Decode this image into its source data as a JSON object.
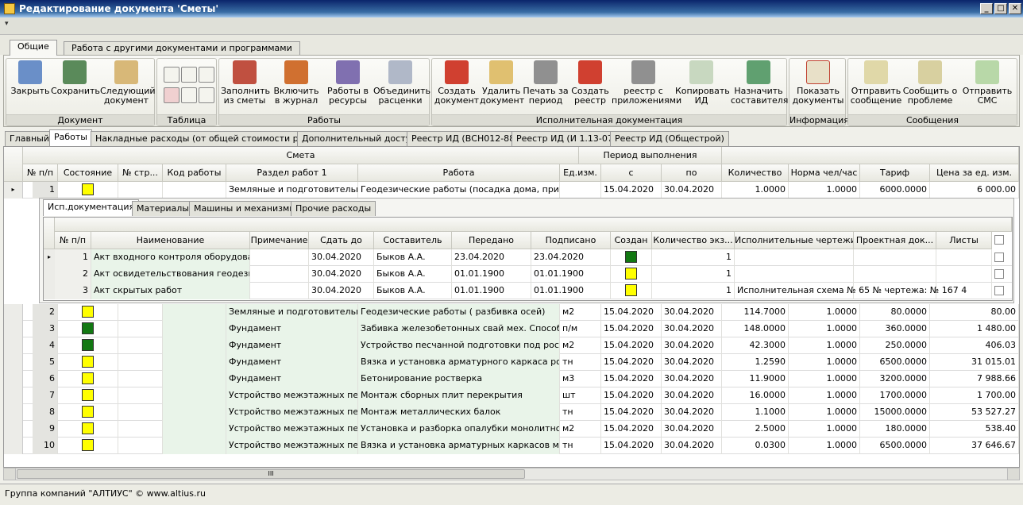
{
  "window": {
    "title": "Редактирование документа 'Сметы'",
    "min": "_",
    "max": "□",
    "close": "✕"
  },
  "qat": {
    "menu": "▾"
  },
  "ribbon_tabs": [
    "Общие",
    "Работа с другими документами и программами"
  ],
  "ribbon": {
    "groups": [
      "Документ",
      "Таблица",
      "Работы",
      "Исполнительная документация",
      "Информация",
      "Сообщения"
    ],
    "buttons": [
      "Закрыть",
      "Сохранить",
      "Следующий документ",
      "Заполнить из сметы",
      "Включить в журнал",
      "Работы в ресурсы",
      "Объединить расценки",
      "Создать документ",
      "Удалить документ",
      "Печать за период",
      "Создать реестр",
      "реестр с приложениями",
      "Копировать ИД",
      "Назначить составителя",
      "Показать документы",
      "Отправить сообщение",
      "Сообщить о проблеме",
      "Отправить СМС"
    ],
    "colors": {
      "arrow_red": "#cc2020",
      "green": "#2a9a40",
      "blue": "#3060c0"
    }
  },
  "doc_tabs": [
    "Главный",
    "Работы",
    "Накладные расходы (от общей стоимости работ)",
    "Дополнительный доступ",
    "Реестр ИД (ВСН012-88)",
    "Реестр ИД (И 1.13-07)",
    "Реестр ИД (Общестрой)"
  ],
  "grid": {
    "group_headers": {
      "smeta": "Смета",
      "period": "Период выполнения"
    },
    "headers": [
      "№ п/п",
      "Состояние",
      "№ стр...",
      "Код работы",
      "Раздел работ 1",
      "Работа",
      "Ед.изм.",
      "с",
      "по",
      "Количество",
      "Норма чел/час",
      "Тариф",
      "Цена за ед. изм."
    ],
    "rows": [
      {
        "n": "1",
        "state": "y",
        "section": "Земляные и подготовительн...",
        "work": "Геодезические работы (посадка дома, привя...",
        "unit": "",
        "from": "15.04.2020",
        "to": "30.04.2020",
        "qty": "1.0000",
        "norm": "1.0000",
        "tariff": "6000.0000",
        "price": "6 000.00"
      },
      {
        "n": "2",
        "state": "y",
        "section": "Земляные и подготовительные",
        "work": "Геодезические работы (  разбивка осей)",
        "unit": "м2",
        "from": "15.04.2020",
        "to": "30.04.2020",
        "qty": "114.7000",
        "norm": "1.0000",
        "tariff": "80.0000",
        "price": "80.00"
      },
      {
        "n": "3",
        "state": "g",
        "section": "Фундамент",
        "work": "Забивка железобетонных свай мех. Способом с у",
        "unit": "п/м",
        "from": "15.04.2020",
        "to": "30.04.2020",
        "qty": "148.0000",
        "norm": "1.0000",
        "tariff": "360.0000",
        "price": "1 480.00"
      },
      {
        "n": "4",
        "state": "g",
        "section": "Фундамент",
        "work": "Устройство песчанной  подготовки  под ростверк",
        "unit": "м2",
        "from": "15.04.2020",
        "to": "30.04.2020",
        "qty": "42.3000",
        "norm": "1.0000",
        "tariff": "250.0000",
        "price": "406.03"
      },
      {
        "n": "5",
        "state": "y",
        "section": "Фундамент",
        "work": "Вязка и установка арматурного каркаса ростверк",
        "unit": "тн",
        "from": "15.04.2020",
        "to": "30.04.2020",
        "qty": "1.2590",
        "norm": "1.0000",
        "tariff": "6500.0000",
        "price": "31 015.01"
      },
      {
        "n": "6",
        "state": "y",
        "section": "Фундамент",
        "work": "Бетонирование ростверка",
        "unit": "м3",
        "from": "15.04.2020",
        "to": "30.04.2020",
        "qty": "11.9000",
        "norm": "1.0000",
        "tariff": "3200.0000",
        "price": "7 988.66"
      },
      {
        "n": "7",
        "state": "y",
        "section": "Устройство межэтажных  перек",
        "work": "Монтаж сборных плит перекрытия",
        "unit": "шт",
        "from": "15.04.2020",
        "to": "30.04.2020",
        "qty": "16.0000",
        "norm": "1.0000",
        "tariff": "1700.0000",
        "price": "1 700.00"
      },
      {
        "n": "8",
        "state": "y",
        "section": "Устройство межэтажных  перек",
        "work": "Монтаж металлических балок",
        "unit": "тн",
        "from": "15.04.2020",
        "to": "30.04.2020",
        "qty": "1.1000",
        "norm": "1.0000",
        "tariff": "15000.0000",
        "price": "53 527.27"
      },
      {
        "n": "9",
        "state": "y",
        "section": "Устройство межэтажных  перек",
        "work": "Установка и разборка опалубки монолитного уча",
        "unit": "м2",
        "from": "15.04.2020",
        "to": "30.04.2020",
        "qty": "2.5000",
        "norm": "1.0000",
        "tariff": "180.0000",
        "price": "538.40"
      },
      {
        "n": "10",
        "state": "y",
        "section": "Устройство межэтажных  перек",
        "work": "Вязка и установка арматурных каркасов моноли",
        "unit": "тн",
        "from": "15.04.2020",
        "to": "30.04.2020",
        "qty": "0.0300",
        "norm": "1.0000",
        "tariff": "6500.0000",
        "price": "37 646.67"
      }
    ]
  },
  "detail": {
    "tabs": [
      "Исп.документация",
      "Материалы",
      "Машины и механизмы",
      "Прочие расходы"
    ],
    "headers": [
      "№ п/п",
      "Наименование",
      "Примечание",
      "Сдать до",
      "Составитель",
      "Передано",
      "Подписано",
      "Создан",
      "Количество экз...",
      "Исполнительные чертежи...",
      "Проектная док...",
      "Листы"
    ],
    "rows": [
      {
        "n": "1",
        "name": "Акт входного контроля оборудова...",
        "note": "",
        "due": "30.04.2020",
        "author": "Быков А.А.",
        "sent": "23.04.2020",
        "signed": "23.04.2020",
        "created": "g",
        "count": "1",
        "drawings": ""
      },
      {
        "n": "2",
        "name": "Акт освидетельствования геодезичес",
        "note": "",
        "due": "30.04.2020",
        "author": "Быков А.А.",
        "sent": "01.01.1900",
        "signed": "01.01.1900",
        "created": "y",
        "count": "1",
        "drawings": ""
      },
      {
        "n": "3",
        "name": "Акт скрытых работ",
        "note": "",
        "due": "30.04.2020",
        "author": "Быков А.А.",
        "sent": "01.01.1900",
        "signed": "01.01.1900",
        "created": "y",
        "count": "1",
        "drawings": "Исполнительная схема № 65 № чертежа: № 167 4"
      }
    ]
  },
  "scroll_grip": "III",
  "status": "Группа компаний \"АЛТИУС\" © www.altius.ru"
}
